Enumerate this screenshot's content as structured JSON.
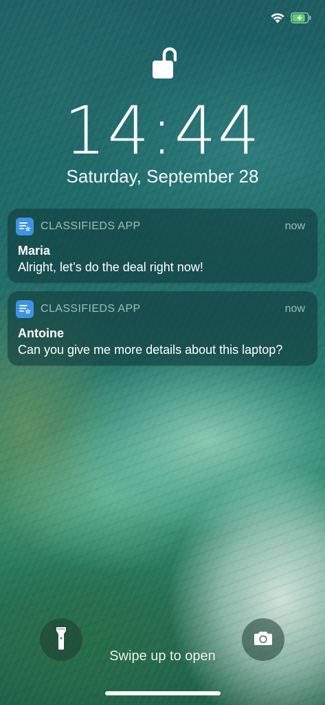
{
  "status_bar": {
    "wifi_icon": "wifi-icon",
    "battery_icon": "battery-charging-icon",
    "battery_level": 0.85,
    "battery_color": "#5bd36a"
  },
  "lock_screen": {
    "lock_icon": "unlocked-padlock-icon",
    "time": "14:44",
    "date": "Saturday, September 28"
  },
  "notifications": [
    {
      "app_name": "CLASSIFIEDS APP",
      "time": "now",
      "title": "Maria",
      "body": "Alright, let’s do the deal right now!",
      "icon": "classifieds-app-icon",
      "icon_color": "#3f93e3"
    },
    {
      "app_name": "CLASSIFIEDS APP",
      "time": "now",
      "title": "Antoine",
      "body": "Can you give me more details about this laptop?",
      "icon": "classifieds-app-icon",
      "icon_color": "#3f93e3"
    }
  ],
  "bottom": {
    "flashlight_icon": "flashlight-icon",
    "camera_icon": "camera-icon",
    "swipe_text": "Swipe up to open"
  }
}
